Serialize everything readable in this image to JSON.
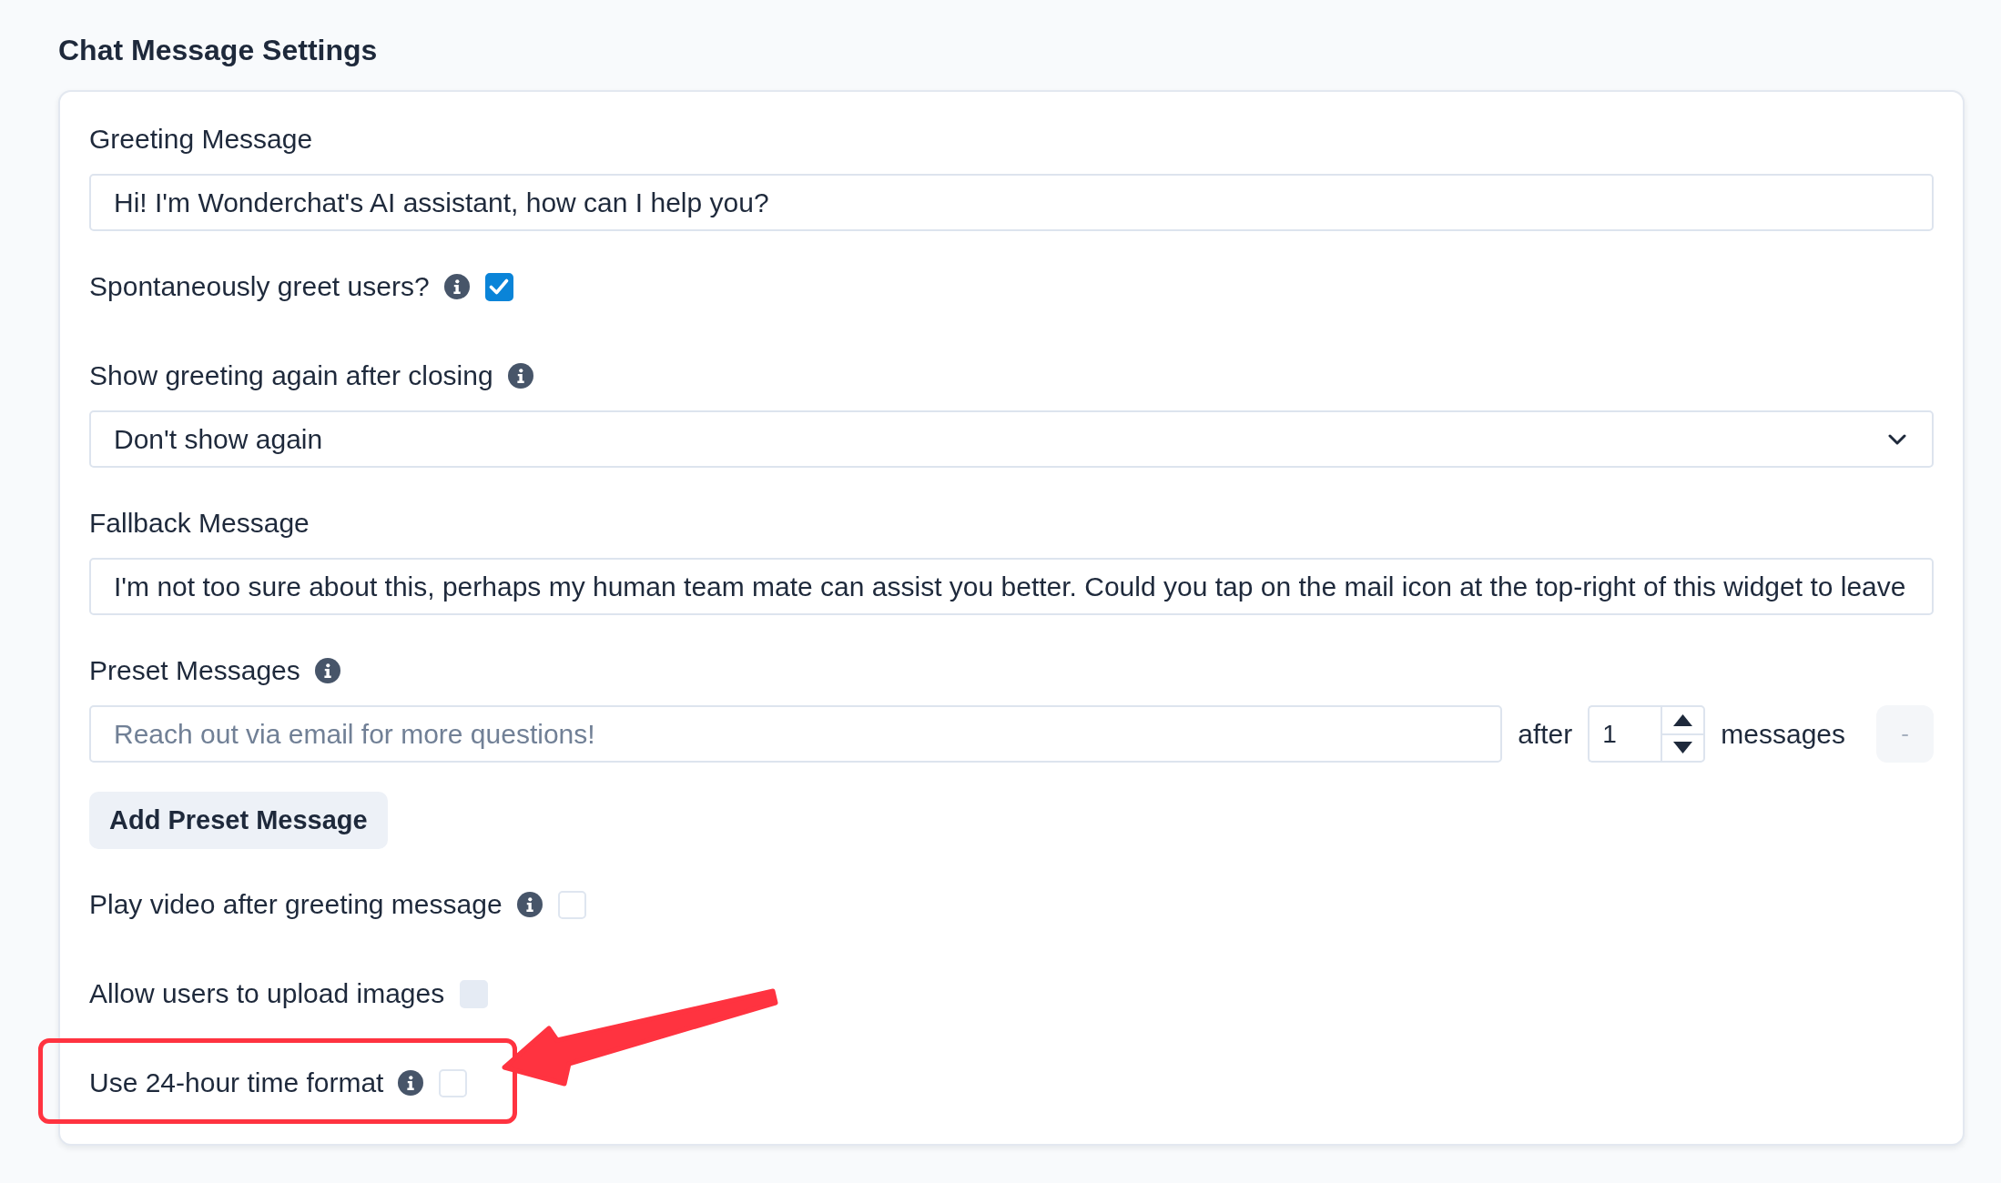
{
  "title": "Chat Message Settings",
  "settings": [
    {
      "kind": "text",
      "label": "Greeting Message",
      "info": false,
      "highlighted": false,
      "value": "Hi! I'm Wonderchat's AI assistant, how can I help you?"
    },
    {
      "kind": "checkbox",
      "label": "Spontaneously greet users?",
      "info": true,
      "highlighted": false,
      "checked": true,
      "disabled": false
    },
    {
      "kind": "select",
      "label": "Show greeting again after closing",
      "info": true,
      "highlighted": false,
      "value": "Don't show again"
    },
    {
      "kind": "text",
      "label": "Fallback Message",
      "info": false,
      "highlighted": false,
      "value": "I'm not too sure about this, perhaps my human team mate can assist you better. Could you tap on the mail icon at the top-right of this widget to leave"
    },
    {
      "kind": "preset",
      "label": "Preset Messages",
      "info": true,
      "highlighted": false,
      "presets": [
        {
          "placeholder": "Reach out via email for more questions!",
          "after_label": "after",
          "count": "1",
          "unit_label": "messages",
          "remove_label": "-"
        }
      ],
      "add_button": "Add Preset Message"
    },
    {
      "kind": "checkbox",
      "label": "Play video after greeting message",
      "info": true,
      "highlighted": false,
      "checked": false,
      "disabled": false
    },
    {
      "kind": "checkbox",
      "label": "Allow users to upload images",
      "info": false,
      "highlighted": false,
      "checked": false,
      "disabled": true
    },
    {
      "kind": "checkbox",
      "label": "Use 24-hour time format",
      "info": true,
      "highlighted": true,
      "checked": false,
      "disabled": false
    }
  ]
}
